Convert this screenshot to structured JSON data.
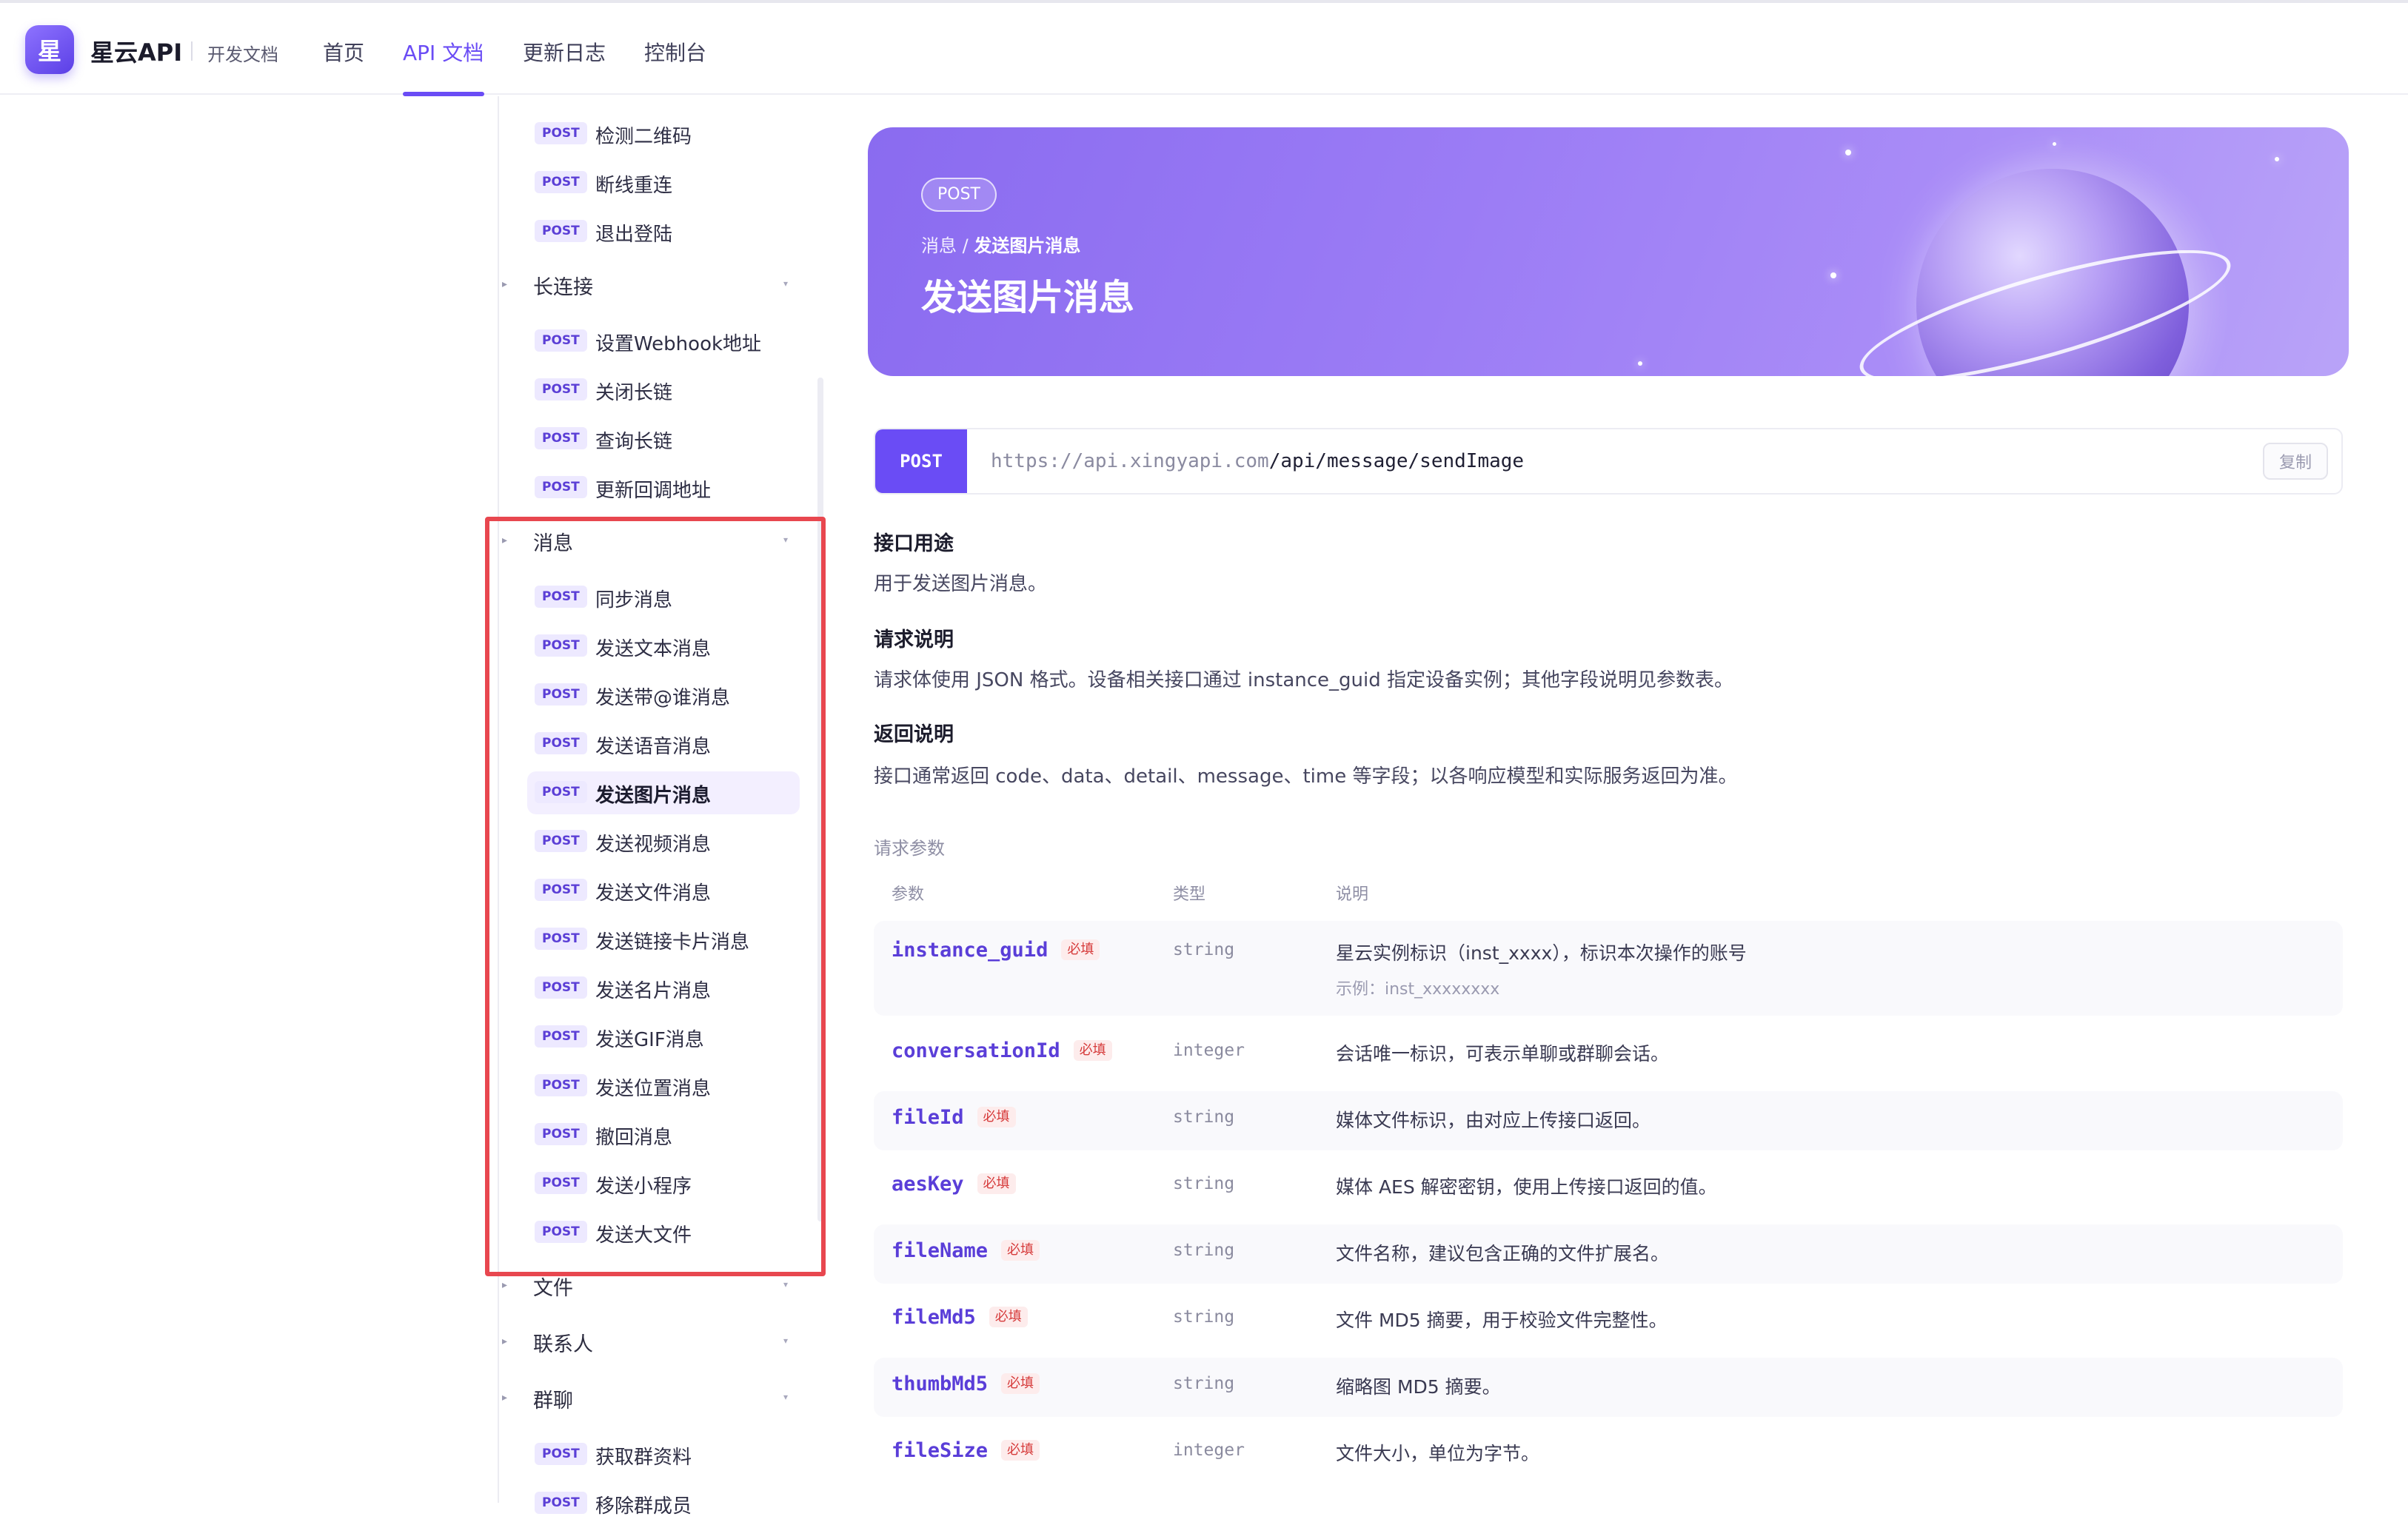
{
  "header": {
    "logo_glyph": "星",
    "brand": "星云API",
    "brand_sub": "开发文档",
    "nav": [
      {
        "label": "首页",
        "active": false
      },
      {
        "label": "API 文档",
        "active": true
      },
      {
        "label": "更新日志",
        "active": false
      },
      {
        "label": "控制台",
        "active": false
      }
    ]
  },
  "sidebar": {
    "method": "POST",
    "top_items": [
      "检测二维码",
      "断线重连",
      "退出登陆"
    ],
    "group_long": {
      "label": "长连接",
      "items": [
        "设置Webhook地址",
        "关闭长链",
        "查询长链",
        "更新回调地址"
      ]
    },
    "group_msg": {
      "label": "消息",
      "items": [
        "同步消息",
        "发送文本消息",
        "发送带@谁消息",
        "发送语音消息",
        "发送图片消息",
        "发送视频消息",
        "发送文件消息",
        "发送链接卡片消息",
        "发送名片消息",
        "发送GIF消息",
        "发送位置消息",
        "撤回消息",
        "发送小程序",
        "发送大文件"
      ],
      "active_item": "发送图片消息"
    },
    "group_file": {
      "label": "文件"
    },
    "group_contact": {
      "label": "联系人"
    },
    "group_group": {
      "label": "群聊",
      "items": [
        "获取群资料",
        "移除群成员"
      ]
    }
  },
  "hero": {
    "badge": "POST",
    "breadcrumb_parent": "消息",
    "breadcrumb_sep": " / ",
    "breadcrumb_current": "发送图片消息",
    "title": "发送图片消息"
  },
  "endpoint": {
    "method": "POST",
    "base": "https://api.xingyapi.com",
    "path": "/api/message/sendImage",
    "copy_label": "复制"
  },
  "sections": {
    "purpose_title": "接口用途",
    "purpose_text": "用于发送图片消息。",
    "request_title": "请求说明",
    "request_text": "请求体使用 JSON 格式。设备相关接口通过 instance_guid 指定设备实例；其他字段说明见参数表。",
    "response_title": "返回说明",
    "response_text": "接口通常返回 code、data、detail、message、time 等字段；以各响应模型和实际服务返回为准。"
  },
  "params": {
    "title": "请求参数",
    "headers": {
      "name": "参数",
      "type": "类型",
      "desc": "说明"
    },
    "required_label": "必填",
    "rows": [
      {
        "name": "instance_guid",
        "type": "string",
        "desc": "星云实例标识（inst_xxxx），标识本次操作的账号",
        "example": "示例：inst_xxxxxxxx"
      },
      {
        "name": "conversationId",
        "type": "integer",
        "desc": "会话唯一标识，可表示单聊或群聊会话。"
      },
      {
        "name": "fileId",
        "type": "string",
        "desc": "媒体文件标识，由对应上传接口返回。"
      },
      {
        "name": "aesKey",
        "type": "string",
        "desc": "媒体 AES 解密密钥，使用上传接口返回的值。"
      },
      {
        "name": "fileName",
        "type": "string",
        "desc": "文件名称，建议包含正确的文件扩展名。"
      },
      {
        "name": "fileMd5",
        "type": "string",
        "desc": "文件 MD5 摘要，用于校验文件完整性。"
      },
      {
        "name": "thumbMd5",
        "type": "string",
        "desc": "缩略图 MD5 摘要。"
      },
      {
        "name": "fileSize",
        "type": "integer",
        "desc": "文件大小，单位为字节。"
      }
    ]
  },
  "colors": {
    "accent": "#6a4cf5",
    "highlight": "#e8474f",
    "required": "#d63b3b"
  }
}
